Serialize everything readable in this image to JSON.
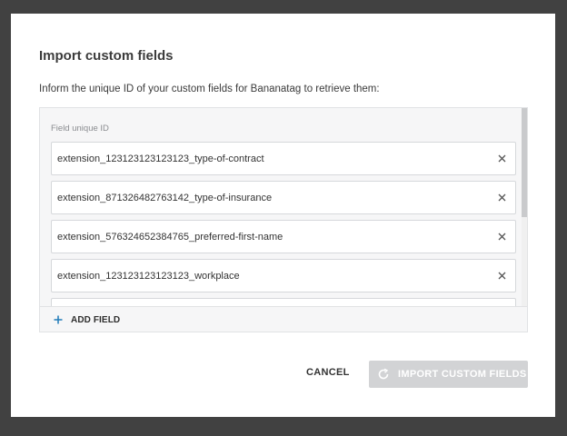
{
  "dialog": {
    "title": "Import custom fields",
    "description": "Inform the unique ID of your custom fields for Bananatag to retrieve them:",
    "field_label": "Field unique ID",
    "fields": [
      {
        "value": "extension_123123123123123_type-of-contract"
      },
      {
        "value": "extension_871326482763142_type-of-insurance"
      },
      {
        "value": "extension_576324652384765_preferred-first-name"
      },
      {
        "value": "extension_123123123123123_workplace"
      },
      {
        "value": ""
      }
    ],
    "add_field_label": "ADD FIELD",
    "cancel_label": "CANCEL",
    "import_label": "IMPORT CUSTOM FIELDS",
    "import_disabled": true,
    "icons": {
      "clear": "close-icon",
      "add": "plus-icon",
      "import": "refresh-icon"
    },
    "colors": {
      "accent": "#1f7ab8",
      "disabled_button": "#d2d3d5",
      "backdrop": "#414141"
    }
  }
}
